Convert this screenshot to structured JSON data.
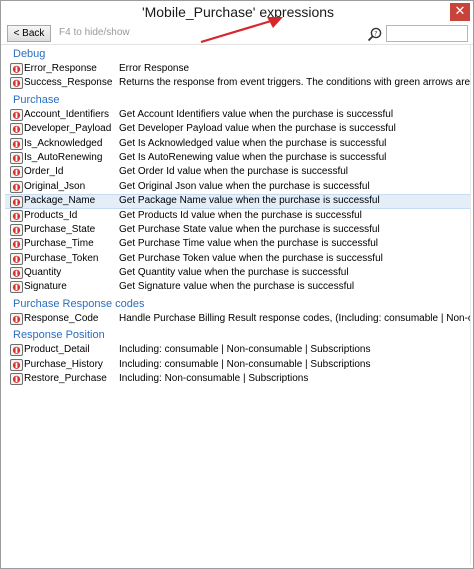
{
  "window": {
    "title": "'Mobile_Purchase' expressions",
    "close_glyph": "✕"
  },
  "toolbar": {
    "back_label": "< Back",
    "hint": "F4 to hide/show",
    "search_value": ""
  },
  "colors": {
    "group_header": "#2b6ec0",
    "selected_row": "#e3eef9",
    "close_button": "#c8433a",
    "arrow": "#d9262c"
  },
  "groups": [
    {
      "title": "Debug",
      "items": [
        {
          "name": "Error_Response",
          "desc": "Error Response"
        },
        {
          "name": "Success_Response",
          "desc": "Returns the response from event triggers. The conditions with green arrows are the event"
        }
      ]
    },
    {
      "title": "Purchase",
      "items": [
        {
          "name": "Account_Identifiers",
          "desc": "Get Account Identifiers value when the purchase is successful"
        },
        {
          "name": "Developer_Payload",
          "desc": "Get Developer Payload value when the purchase is successful"
        },
        {
          "name": "Is_Acknowledged",
          "desc": "Get Is Acknowledged value when the purchase is successful"
        },
        {
          "name": "Is_AutoRenewing",
          "desc": "Get Is AutoRenewing value when the purchase is successful"
        },
        {
          "name": "Order_Id",
          "desc": "Get Order Id value when the purchase is successful"
        },
        {
          "name": "Original_Json",
          "desc": "Get Original Json value when the purchase is successful"
        },
        {
          "name": "Package_Name",
          "desc": "Get Package Name value when the purchase is successful",
          "selected": true
        },
        {
          "name": "Products_Id",
          "desc": "Get Products Id value when the purchase is successful"
        },
        {
          "name": "Purchase_State",
          "desc": "Get Purchase State value when the purchase is successful"
        },
        {
          "name": "Purchase_Time",
          "desc": "Get Purchase Time value when the purchase is successful"
        },
        {
          "name": "Purchase_Token",
          "desc": "Get Purchase Token value when the purchase is successful"
        },
        {
          "name": "Quantity",
          "desc": "Get Quantity value when the purchase is successful"
        },
        {
          "name": "Signature",
          "desc": "Get Signature value when the purchase is successful"
        }
      ]
    },
    {
      "title": "Purchase Response codes",
      "items": [
        {
          "name": "Response_Code",
          "desc": "Handle Purchase Billing Result response codes, (Including: consumable | Non-consumable"
        }
      ]
    },
    {
      "title": "Response Position",
      "items": [
        {
          "name": "Product_Detail",
          "desc": "Including: consumable | Non-consumable | Subscriptions"
        },
        {
          "name": "Purchase_History",
          "desc": "Including: consumable | Non-consumable | Subscriptions"
        },
        {
          "name": "Restore_Purchase",
          "desc": "Including: Non-consumable | Subscriptions"
        }
      ]
    }
  ]
}
